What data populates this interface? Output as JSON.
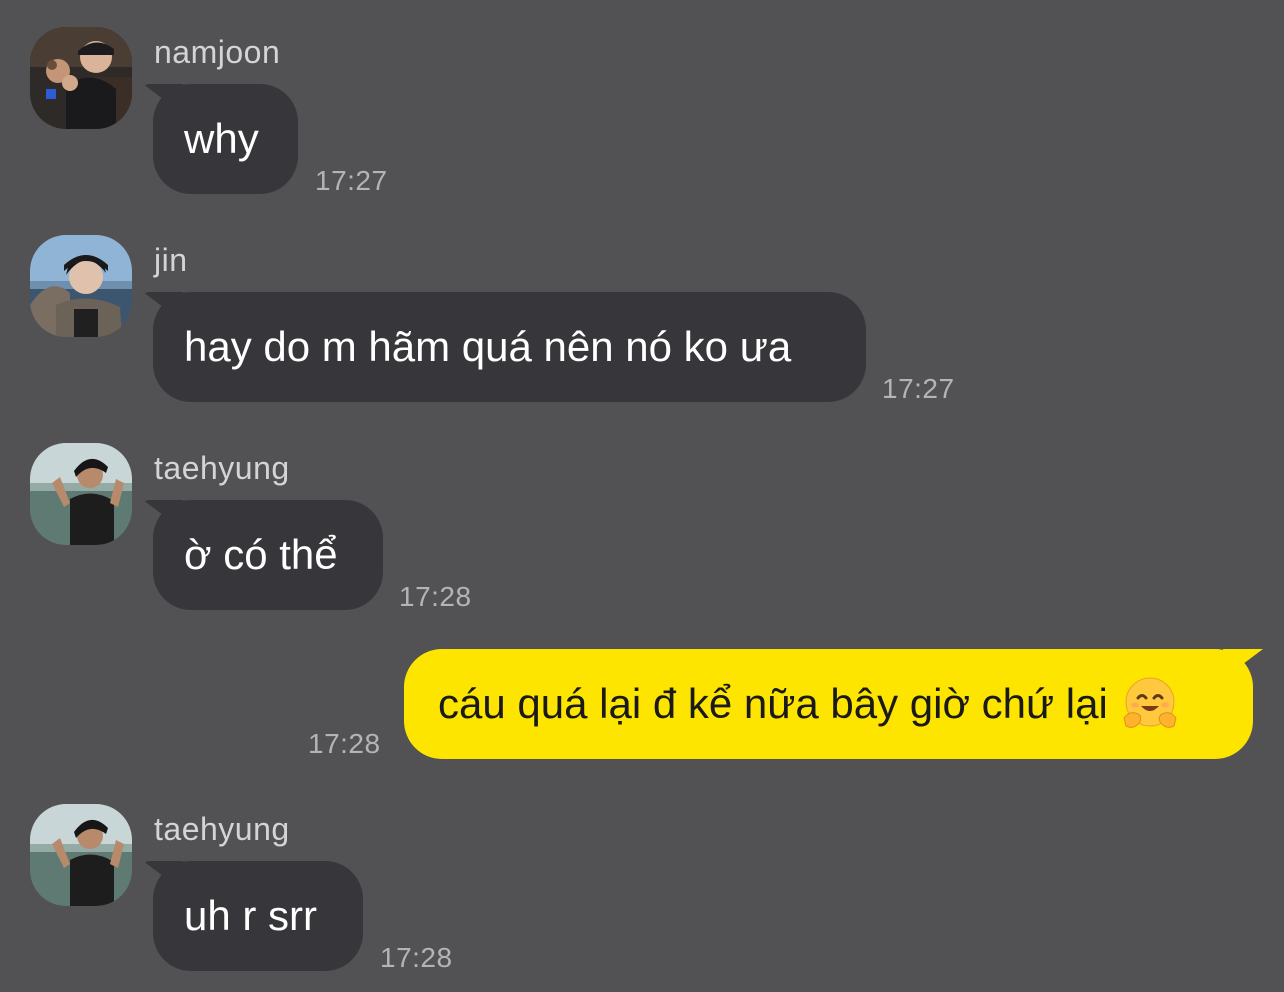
{
  "messages": [
    {
      "sender": "namjoon",
      "text": "why",
      "time": "17:27",
      "direction": "incoming",
      "avatar_icon": "avatar-namjoon"
    },
    {
      "sender": "jin",
      "text": "hay do m hãm quá nên nó ko ưa",
      "time": "17:27",
      "direction": "incoming",
      "avatar_icon": "avatar-jin"
    },
    {
      "sender": "taehyung",
      "text": "ờ có thể",
      "time": "17:28",
      "direction": "incoming",
      "avatar_icon": "avatar-taehyung"
    },
    {
      "sender": "",
      "text": "cáu quá lại đ kể nữa bây giờ chứ lại",
      "emoji": "hugging-face-emoji",
      "time": "17:28",
      "direction": "outgoing"
    },
    {
      "sender": "taehyung",
      "text": "uh r srr",
      "time": "17:28",
      "direction": "incoming",
      "avatar_icon": "avatar-taehyung"
    }
  ],
  "colors": {
    "background": "#525154",
    "incoming_bubble": "#37363a",
    "outgoing_bubble": "#fee500",
    "sender_text": "#d4d4d6",
    "timestamp_text": "#b4b3b7"
  }
}
